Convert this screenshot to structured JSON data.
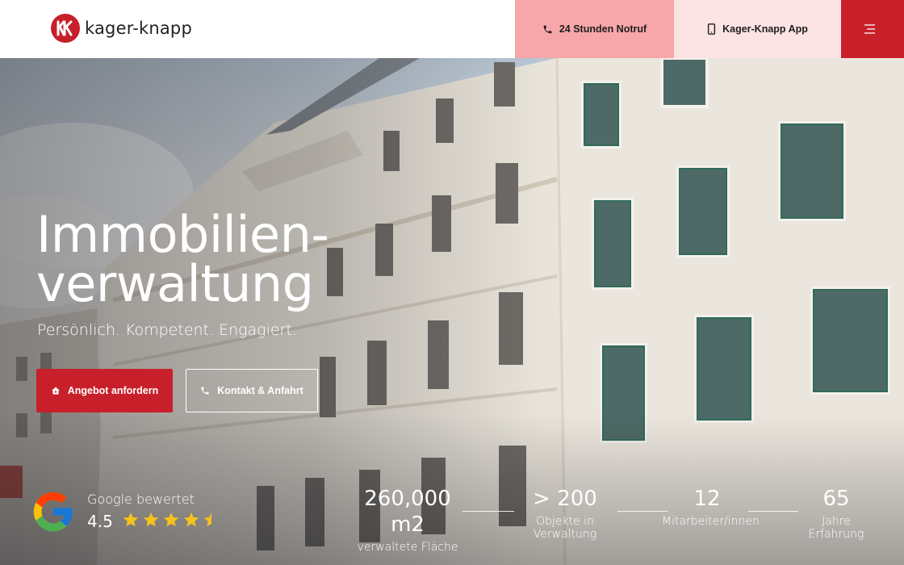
{
  "header": {
    "logo_text": "kager-knapp",
    "notruf_label": "24 Stunden Notruf",
    "app_label": "Kager-Knapp App"
  },
  "hero": {
    "title_line1": "Immobilien-",
    "title_line2": "verwaltung",
    "subtitle": "Persönlich. Kompetent. Engagiert.",
    "primary_button": "Angebot anfordern",
    "secondary_button": "Kontakt & Anfahrt"
  },
  "rating": {
    "label": "Google bewertet",
    "value": "4.5",
    "stars": 4.5
  },
  "stats": [
    {
      "value": "260,000 m2",
      "label": "verwaltete Fläche"
    },
    {
      "value": "> 200",
      "label": "Objekte in Verwaltung"
    },
    {
      "value": "12",
      "label": "Mitarbeiter/innen"
    },
    {
      "value": "65",
      "label": "Jahre Erfahrung"
    }
  ],
  "colors": {
    "brand_red": "#c8202a",
    "notruf_bg": "#f7a7a9",
    "app_bg": "#fce3e4",
    "star": "#f6c21c"
  },
  "icons": {
    "phone": "phone-icon",
    "mobile": "mobile-icon",
    "menu": "hamburger-menu-icon",
    "house": "house-icon",
    "google": "google-logo-icon",
    "star": "star-icon"
  }
}
